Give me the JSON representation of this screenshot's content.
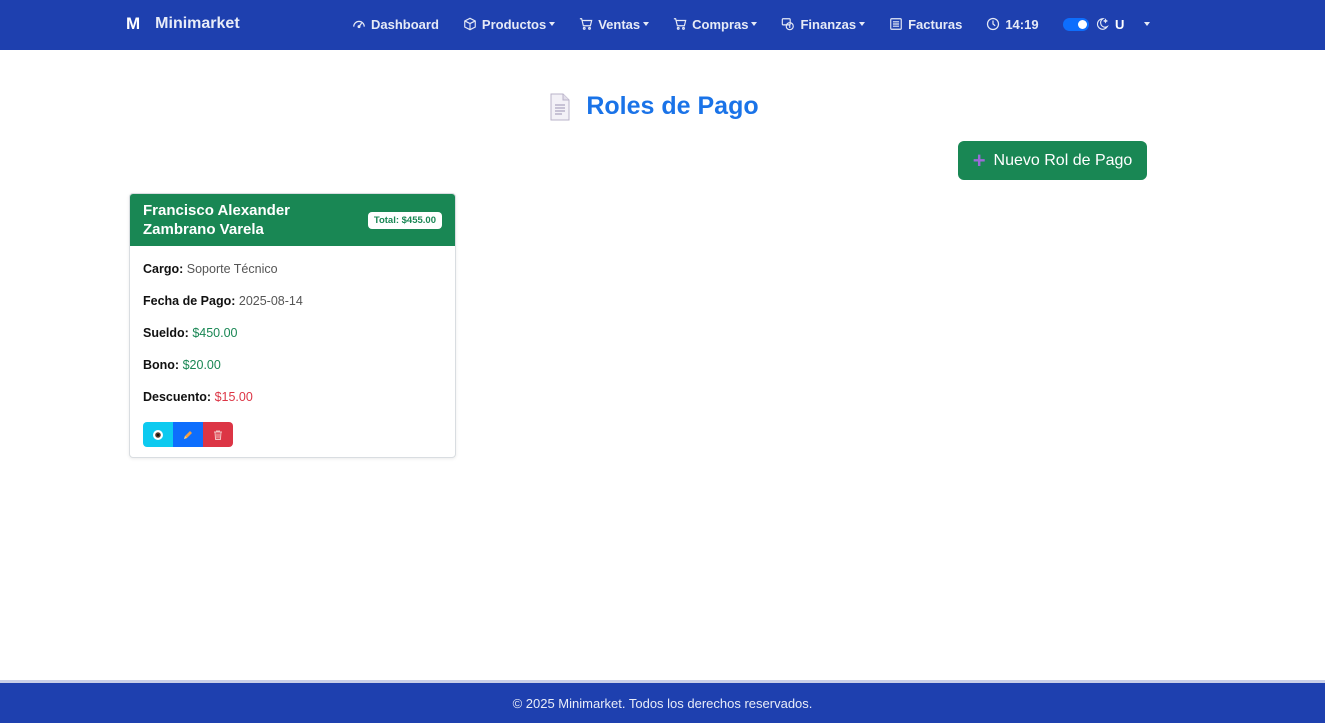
{
  "brand": {
    "logo": "M",
    "name": "Minimarket"
  },
  "nav": {
    "items": [
      {
        "label": "Dashboard",
        "icon": "gauge-icon",
        "dropdown": false
      },
      {
        "label": "Productos",
        "icon": "box-icon",
        "dropdown": true
      },
      {
        "label": "Ventas",
        "icon": "cart-icon",
        "dropdown": true
      },
      {
        "label": "Compras",
        "icon": "cart-icon",
        "dropdown": true
      },
      {
        "label": "Finanzas",
        "icon": "cash-icon",
        "dropdown": true
      },
      {
        "label": "Facturas",
        "icon": "receipt-icon",
        "dropdown": false
      }
    ],
    "clock": "14:19",
    "user": "U"
  },
  "page": {
    "title": "Roles de Pago",
    "new_button": "Nuevo Rol de Pago"
  },
  "card": {
    "name": "Francisco Alexander Zambrano Varela",
    "total": "Total: $455.00",
    "fields": [
      {
        "label": "Cargo:",
        "value": "Soporte Técnico"
      },
      {
        "label": "Fecha de Pago:",
        "value": "2025-08-14"
      },
      {
        "label": "Sueldo:",
        "value": "$450.00"
      },
      {
        "label": "Bono:",
        "value": "$20.00"
      },
      {
        "label": "Descuento:",
        "value": "$15.00"
      }
    ]
  },
  "footer": {
    "text": "© 2025 Minimarket. Todos los derechos reservados."
  },
  "colors": {
    "navbar": "#1e40af",
    "accent": "#1a73e8",
    "success": "#198754",
    "danger": "#dc3545",
    "info": "#0dcaf0",
    "primary": "#0d6efd"
  }
}
